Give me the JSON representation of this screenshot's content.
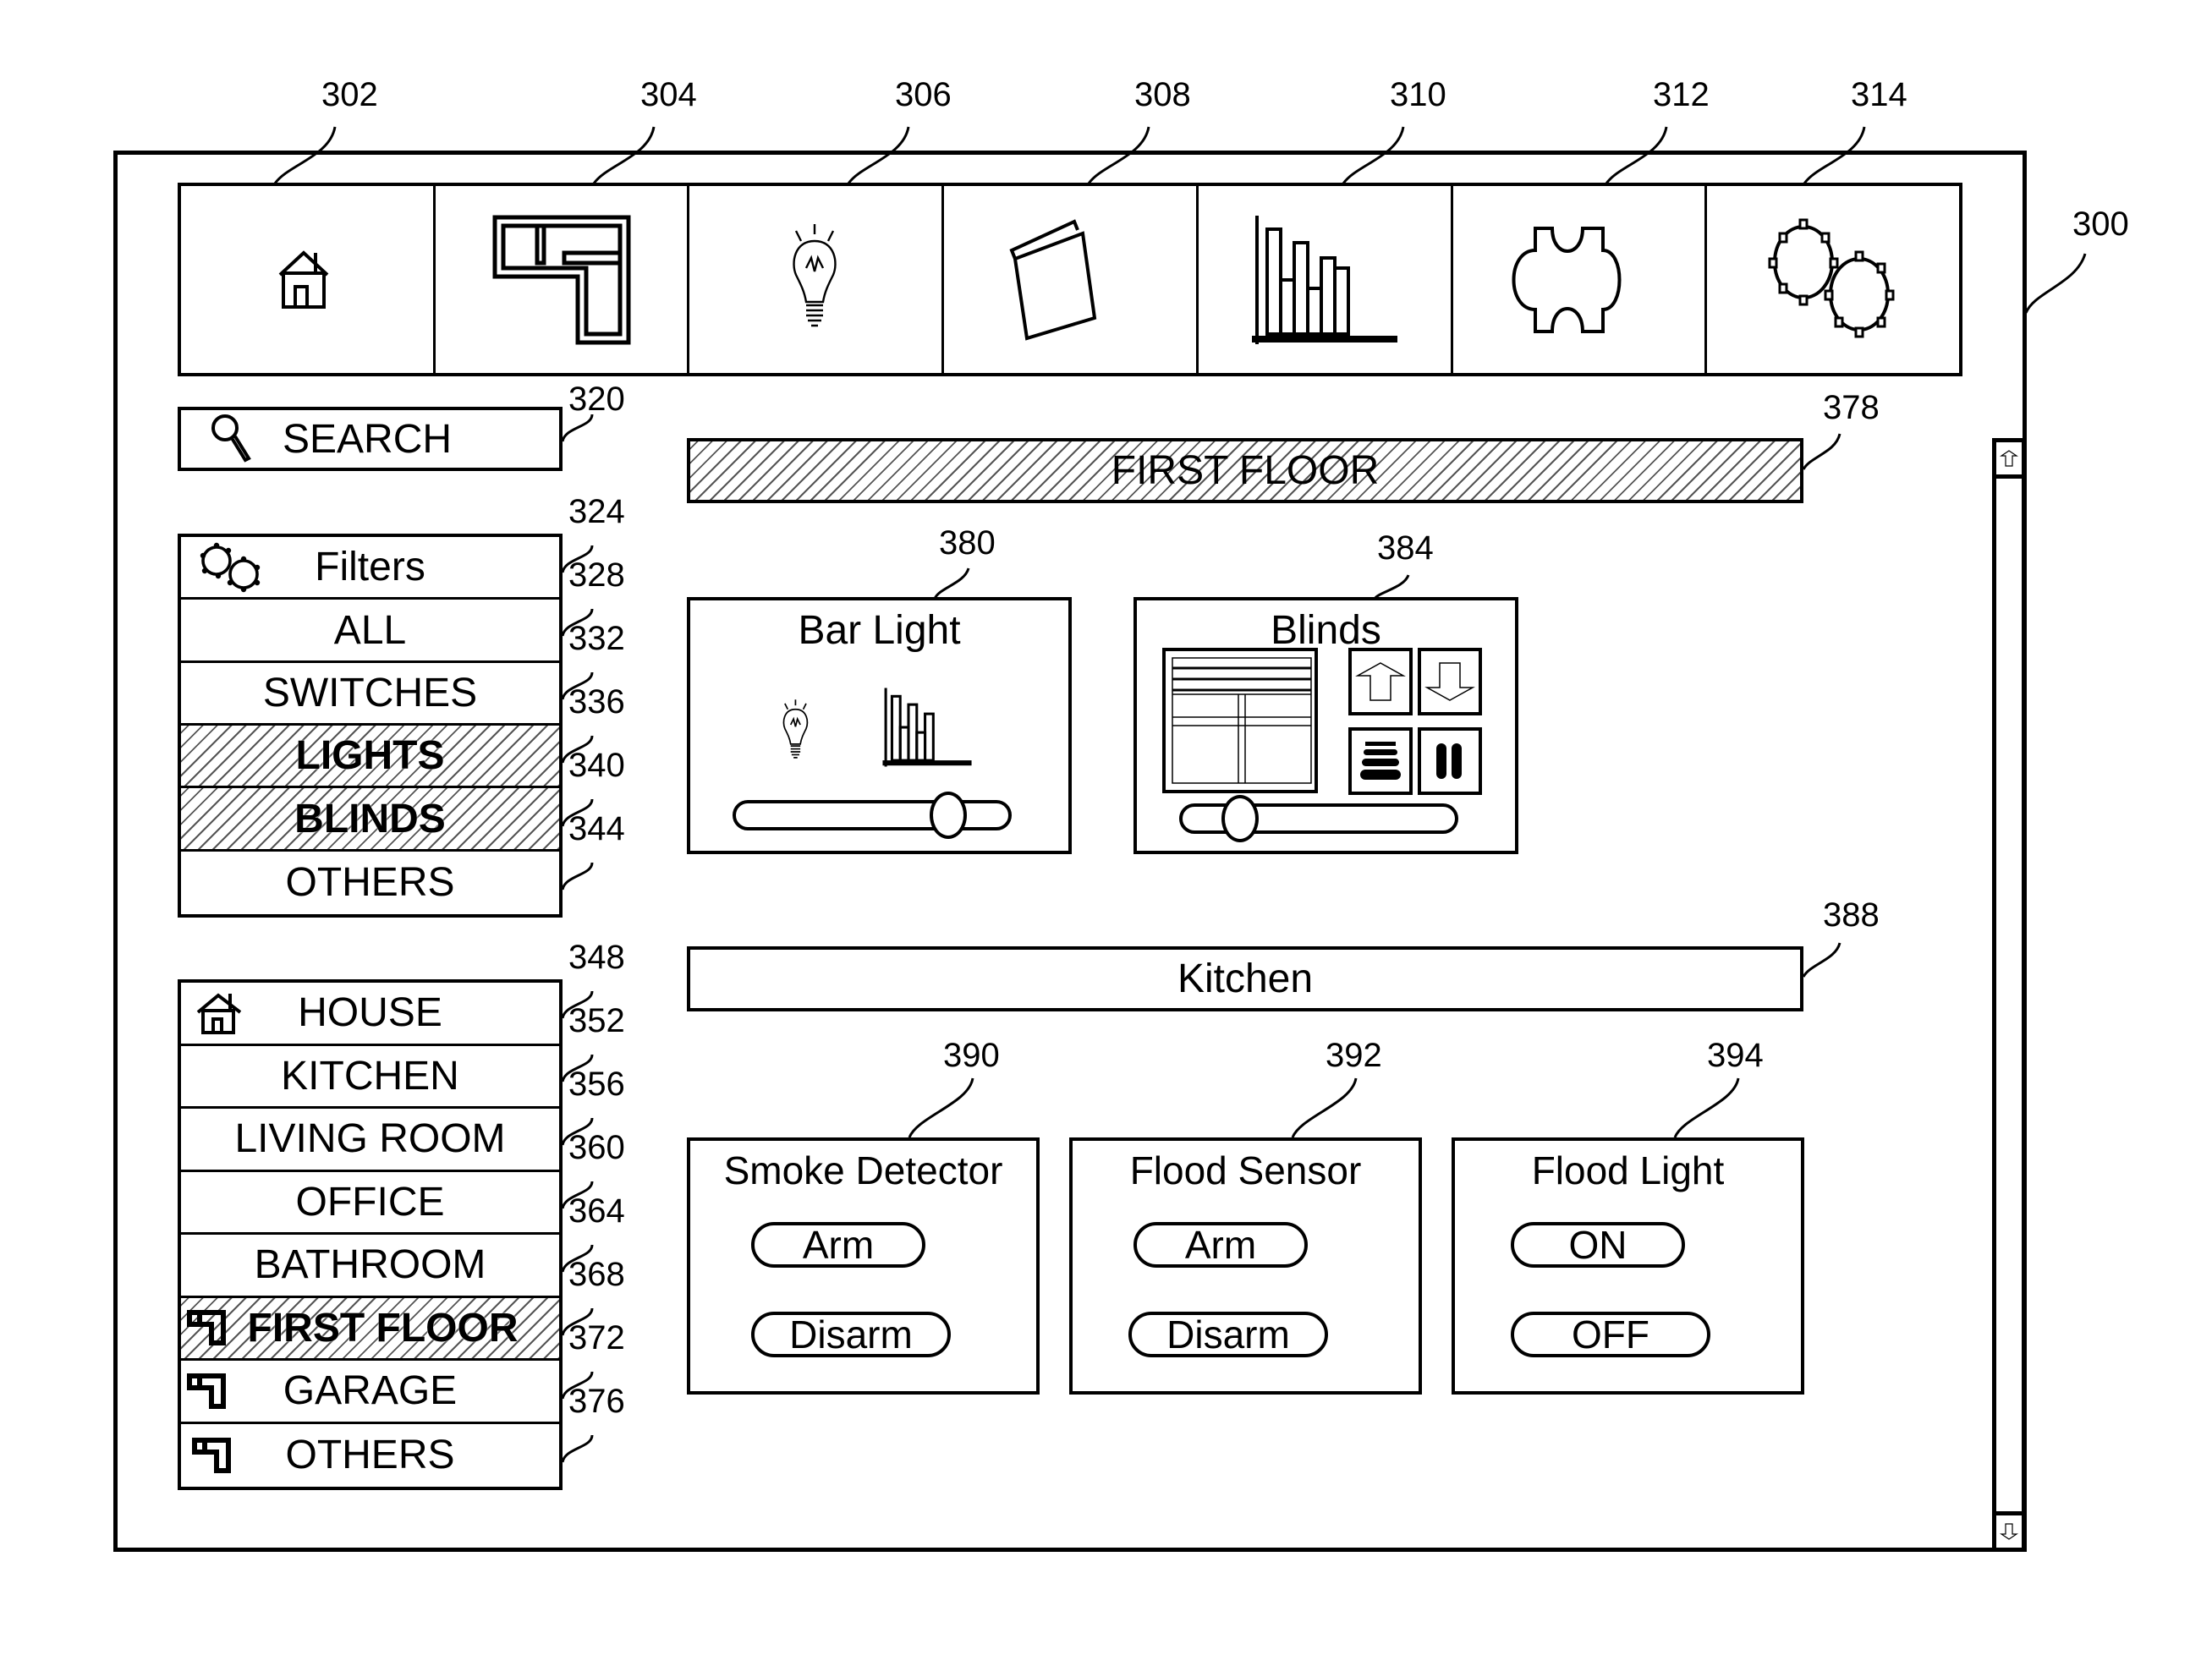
{
  "figure_label": "300",
  "toolbar": {
    "items": [
      {
        "icon": "house-icon",
        "ref": "302"
      },
      {
        "icon": "floor-plan-icon",
        "ref": "304"
      },
      {
        "icon": "light-bulb-icon",
        "ref": "306"
      },
      {
        "icon": "clapperboard-icon",
        "ref": "308"
      },
      {
        "icon": "bar-chart-icon",
        "ref": "310"
      },
      {
        "icon": "puzzle-icon",
        "ref": "312"
      },
      {
        "icon": "gears-icon",
        "ref": "314"
      }
    ]
  },
  "search": {
    "label": "SEARCH",
    "icon": "search-icon",
    "ref": "320"
  },
  "filters": {
    "header": {
      "label": "Filters",
      "icon": "gears-icon",
      "ref": "324"
    },
    "items": [
      {
        "label": "ALL",
        "ref": "328",
        "selected": false
      },
      {
        "label": "SWITCHES",
        "ref": "332",
        "selected": false
      },
      {
        "label": "LIGHTS",
        "ref": "336",
        "selected": true
      },
      {
        "label": "BLINDS",
        "ref": "340",
        "selected": true
      },
      {
        "label": "OTHERS",
        "ref": "344",
        "selected": false
      }
    ]
  },
  "locations": {
    "items": [
      {
        "label": "HOUSE",
        "ref": "348",
        "icon": "house-icon",
        "selected": false
      },
      {
        "label": "KITCHEN",
        "ref": "352",
        "icon": "",
        "selected": false
      },
      {
        "label": "LIVING ROOM",
        "ref": "356",
        "icon": "",
        "selected": false
      },
      {
        "label": "OFFICE",
        "ref": "360",
        "icon": "",
        "selected": false
      },
      {
        "label": "BATHROOM",
        "ref": "364",
        "icon": "",
        "selected": false
      },
      {
        "label": "FIRST FLOOR",
        "ref": "368",
        "icon": "floor-icon",
        "selected": true
      },
      {
        "label": "GARAGE",
        "ref": "372",
        "icon": "floor-icon",
        "selected": false
      },
      {
        "label": "OTHERS",
        "ref": "376",
        "icon": "floor-icon",
        "selected": false
      }
    ]
  },
  "main": {
    "section1": {
      "title": "FIRST FLOOR",
      "ref": "378",
      "selected": true,
      "cards": [
        {
          "title": "Bar Light",
          "ref": "380",
          "slider_value": 0.78
        },
        {
          "title": "Blinds",
          "ref": "384",
          "slider_value": 0.21,
          "buttons": [
            "up-arrow",
            "down-arrow",
            "open-blinds",
            "close-blinds"
          ]
        }
      ]
    },
    "section2": {
      "title": "Kitchen",
      "ref": "388",
      "cards": [
        {
          "title": "Smoke Detector",
          "ref": "390",
          "buttons": [
            {
              "label": "Arm",
              "active": false
            },
            {
              "label": "Disarm",
              "active": true
            }
          ]
        },
        {
          "title": "Flood Sensor",
          "ref": "392",
          "buttons": [
            {
              "label": "Arm",
              "active": true
            },
            {
              "label": "Disarm",
              "active": false
            }
          ]
        },
        {
          "title": "Flood Light",
          "ref": "394",
          "buttons": [
            {
              "label": "ON",
              "active": false
            },
            {
              "label": "OFF",
              "active": true
            }
          ]
        }
      ]
    }
  }
}
